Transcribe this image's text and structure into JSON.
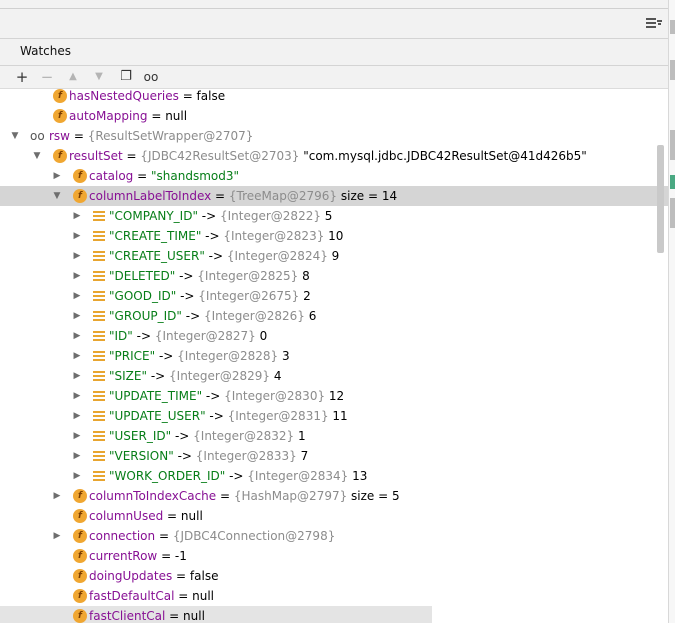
{
  "panel": {
    "title": "Watches"
  },
  "toolbar": {
    "add_icon": "plus-icon",
    "remove_icon": "minus-icon",
    "up_icon": "arrow-up-icon",
    "down_icon": "arrow-down-icon",
    "copy_icon": "copy-icon",
    "watch_icon": "glasses-icon"
  },
  "tree": {
    "r0": {
      "name": "hasNestedQueries",
      "value": " = false"
    },
    "r1": {
      "name": "autoMapping",
      "value": " = null"
    },
    "r2": {
      "name": "rsw",
      "value": " = ",
      "ref": "{ResultSetWrapper@2707}"
    },
    "r3": {
      "name": "resultSet",
      "value": " = ",
      "ref": "{JDBC42ResultSet@2703}",
      "extra": " \"com.mysql.jdbc.JDBC42ResultSet@41d426b5\""
    },
    "r4": {
      "name": "catalog",
      "value": " = ",
      "str": "\"shandsmod3\""
    },
    "r5": {
      "name": "columnLabelToIndex",
      "value": " = ",
      "ref": "{TreeMap@2796}",
      "extra": "  size = 14"
    },
    "entries": [
      {
        "key": "\"COMPANY_ID\"",
        "arrow": " -> ",
        "ref": "{Integer@2822}",
        "val": " 5"
      },
      {
        "key": "\"CREATE_TIME\"",
        "arrow": " -> ",
        "ref": "{Integer@2823}",
        "val": " 10"
      },
      {
        "key": "\"CREATE_USER\"",
        "arrow": " -> ",
        "ref": "{Integer@2824}",
        "val": " 9"
      },
      {
        "key": "\"DELETED\"",
        "arrow": " -> ",
        "ref": "{Integer@2825}",
        "val": " 8"
      },
      {
        "key": "\"GOOD_ID\"",
        "arrow": " -> ",
        "ref": "{Integer@2675}",
        "val": " 2"
      },
      {
        "key": "\"GROUP_ID\"",
        "arrow": " -> ",
        "ref": "{Integer@2826}",
        "val": " 6"
      },
      {
        "key": "\"ID\"",
        "arrow": " -> ",
        "ref": "{Integer@2827}",
        "val": " 0"
      },
      {
        "key": "\"PRICE\"",
        "arrow": " -> ",
        "ref": "{Integer@2828}",
        "val": " 3"
      },
      {
        "key": "\"SIZE\"",
        "arrow": " -> ",
        "ref": "{Integer@2829}",
        "val": " 4"
      },
      {
        "key": "\"UPDATE_TIME\"",
        "arrow": " -> ",
        "ref": "{Integer@2830}",
        "val": " 12"
      },
      {
        "key": "\"UPDATE_USER\"",
        "arrow": " -> ",
        "ref": "{Integer@2831}",
        "val": " 11"
      },
      {
        "key": "\"USER_ID\"",
        "arrow": " -> ",
        "ref": "{Integer@2832}",
        "val": " 1"
      },
      {
        "key": "\"VERSION\"",
        "arrow": " -> ",
        "ref": "{Integer@2833}",
        "val": " 7"
      },
      {
        "key": "\"WORK_ORDER_ID\"",
        "arrow": " -> ",
        "ref": "{Integer@2834}",
        "val": " 13"
      }
    ],
    "r20": {
      "name": "columnToIndexCache",
      "value": " = ",
      "ref": "{HashMap@2797}",
      "extra": "  size = 5"
    },
    "r21": {
      "name": "columnUsed",
      "value": " = null"
    },
    "r22": {
      "name": "connection",
      "value": " = ",
      "ref": "{JDBC4Connection@2798}"
    },
    "r23": {
      "name": "currentRow",
      "value": " = -1"
    },
    "r24": {
      "name": "doingUpdates",
      "value": " = false"
    },
    "r25": {
      "name": "fastDefaultCal",
      "value": " = null"
    },
    "r26": {
      "name": "fastClientCal",
      "value": " = null"
    }
  },
  "icons": {
    "field": "f",
    "collapsed": "▶",
    "expanded": "▼"
  },
  "colors": {
    "field_icon": "#f0a732",
    "selection": "#d5d5d5",
    "string": "#067d17",
    "reference": "#8c8c8c"
  }
}
